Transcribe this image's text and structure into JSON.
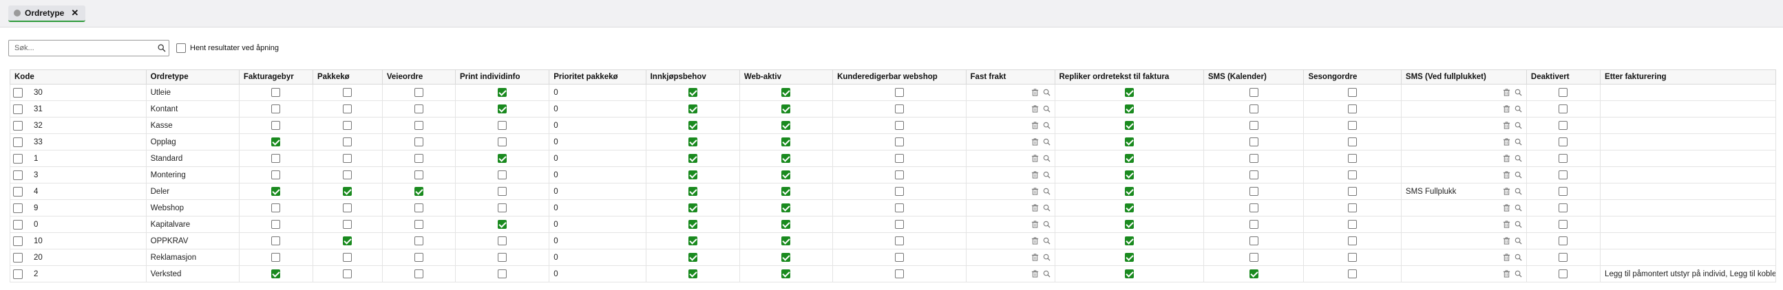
{
  "tabs": [
    {
      "label": "Ordretype"
    }
  ],
  "search": {
    "placeholder": "Søk...",
    "value": ""
  },
  "autoload": {
    "label": "Hent resultater ved åpning",
    "checked": false
  },
  "columns": [
    "Kode",
    "Ordretype",
    "Fakturagebyr",
    "Pakkekø",
    "Veieordre",
    "Print individinfo",
    "Prioritet pakkekø",
    "Innkjøpsbehov",
    "Web-aktiv",
    "Kunderedigerbar webshop",
    "Fast frakt",
    "Repliker ordretekst til faktura",
    "SMS (Kalender)",
    "Sesongordre",
    "SMS (Ved fullplukket)",
    "Deaktivert",
    "Etter fakturering"
  ],
  "rows": [
    {
      "kode": "30",
      "ordretype": "Utleie",
      "fakturagebyr": false,
      "pakkeko": false,
      "veieordre": false,
      "print": true,
      "prioritet": "0",
      "innkjop": true,
      "web": true,
      "kunderedig": false,
      "fastfrakt": "",
      "repliker": true,
      "smskal": false,
      "sesong": false,
      "smsfull": "",
      "deakt": false,
      "etter": ""
    },
    {
      "kode": "31",
      "ordretype": "Kontant",
      "fakturagebyr": false,
      "pakkeko": false,
      "veieordre": false,
      "print": true,
      "prioritet": "0",
      "innkjop": true,
      "web": true,
      "kunderedig": false,
      "fastfrakt": "",
      "repliker": true,
      "smskal": false,
      "sesong": false,
      "smsfull": "",
      "deakt": false,
      "etter": ""
    },
    {
      "kode": "32",
      "ordretype": "Kasse",
      "fakturagebyr": false,
      "pakkeko": false,
      "veieordre": false,
      "print": false,
      "prioritet": "0",
      "innkjop": true,
      "web": true,
      "kunderedig": false,
      "fastfrakt": "",
      "repliker": true,
      "smskal": false,
      "sesong": false,
      "smsfull": "",
      "deakt": false,
      "etter": ""
    },
    {
      "kode": "33",
      "ordretype": "Opplag",
      "fakturagebyr": true,
      "pakkeko": false,
      "veieordre": false,
      "print": false,
      "prioritet": "0",
      "innkjop": true,
      "web": true,
      "kunderedig": false,
      "fastfrakt": "",
      "repliker": true,
      "smskal": false,
      "sesong": false,
      "smsfull": "",
      "deakt": false,
      "etter": ""
    },
    {
      "kode": "1",
      "ordretype": "Standard",
      "fakturagebyr": false,
      "pakkeko": false,
      "veieordre": false,
      "print": true,
      "prioritet": "0",
      "innkjop": true,
      "web": true,
      "kunderedig": false,
      "fastfrakt": "",
      "repliker": true,
      "smskal": false,
      "sesong": false,
      "smsfull": "",
      "deakt": false,
      "etter": ""
    },
    {
      "kode": "3",
      "ordretype": "Montering",
      "fakturagebyr": false,
      "pakkeko": false,
      "veieordre": false,
      "print": false,
      "prioritet": "0",
      "innkjop": true,
      "web": true,
      "kunderedig": false,
      "fastfrakt": "",
      "repliker": true,
      "smskal": false,
      "sesong": false,
      "smsfull": "",
      "deakt": false,
      "etter": ""
    },
    {
      "kode": "4",
      "ordretype": "Deler",
      "fakturagebyr": true,
      "pakkeko": true,
      "veieordre": true,
      "print": false,
      "prioritet": "0",
      "innkjop": true,
      "web": true,
      "kunderedig": false,
      "fastfrakt": "",
      "repliker": true,
      "smskal": false,
      "sesong": false,
      "smsfull": "SMS Fullplukk",
      "deakt": false,
      "etter": ""
    },
    {
      "kode": "9",
      "ordretype": "Webshop",
      "fakturagebyr": false,
      "pakkeko": false,
      "veieordre": false,
      "print": false,
      "prioritet": "0",
      "innkjop": true,
      "web": true,
      "kunderedig": false,
      "fastfrakt": "",
      "repliker": true,
      "smskal": false,
      "sesong": false,
      "smsfull": "",
      "deakt": false,
      "etter": ""
    },
    {
      "kode": "0",
      "ordretype": "Kapitalvare",
      "fakturagebyr": false,
      "pakkeko": false,
      "veieordre": false,
      "print": true,
      "prioritet": "0",
      "innkjop": true,
      "web": true,
      "kunderedig": false,
      "fastfrakt": "",
      "repliker": true,
      "smskal": false,
      "sesong": false,
      "smsfull": "",
      "deakt": false,
      "etter": ""
    },
    {
      "kode": "10",
      "ordretype": "OPPKRAV",
      "fakturagebyr": false,
      "pakkeko": true,
      "veieordre": false,
      "print": false,
      "prioritet": "0",
      "innkjop": true,
      "web": true,
      "kunderedig": false,
      "fastfrakt": "",
      "repliker": true,
      "smskal": false,
      "sesong": false,
      "smsfull": "",
      "deakt": false,
      "etter": ""
    },
    {
      "kode": "20",
      "ordretype": "Reklamasjon",
      "fakturagebyr": false,
      "pakkeko": false,
      "veieordre": false,
      "print": false,
      "prioritet": "0",
      "innkjop": true,
      "web": true,
      "kunderedig": false,
      "fastfrakt": "",
      "repliker": true,
      "smskal": false,
      "sesong": false,
      "smsfull": "",
      "deakt": false,
      "etter": ""
    },
    {
      "kode": "2",
      "ordretype": "Verksted",
      "fakturagebyr": true,
      "pakkeko": false,
      "veieordre": false,
      "print": false,
      "prioritet": "0",
      "innkjop": true,
      "web": true,
      "kunderedig": false,
      "fastfrakt": "",
      "repliker": true,
      "smskal": true,
      "sesong": false,
      "smsfull": "",
      "deakt": false,
      "etter": "Legg til påmontert utstyr på individ, Legg til koblede individer"
    }
  ],
  "icons": {
    "delete": "trash-icon",
    "lookup": "search-icon",
    "tab_status": "status-dot-icon",
    "close": "close-icon"
  },
  "colors": {
    "checked": "#1a8a1f",
    "tab_accent": "#2e9a3a"
  }
}
